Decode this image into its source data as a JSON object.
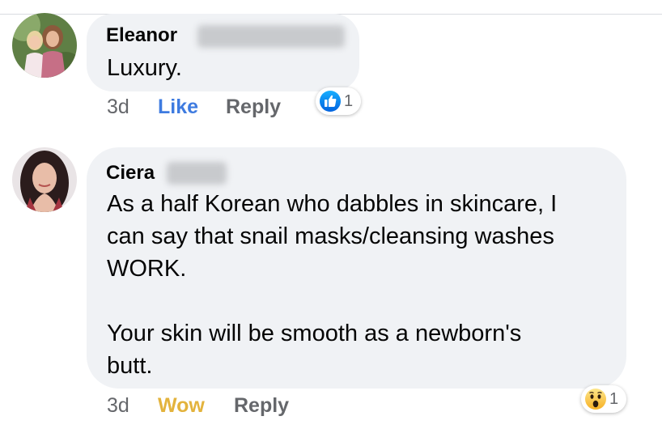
{
  "colors": {
    "bubble": "#f0f2f5",
    "like_blue": "#3e7be0",
    "wow_yellow": "#e3b33d",
    "muted_gray": "#65676b"
  },
  "comments": [
    {
      "author": "Eleanor",
      "text": "Luxury.",
      "timestamp": "3d",
      "reaction_action": "Like",
      "reply_label": "Reply",
      "reaction_icon": "like-icon",
      "reaction_count": "1"
    },
    {
      "author": "Ciera",
      "text": "As a half Korean who dabbles in skincare, I\ncan say that snail masks/cleansing washes\nWORK.\n\nYour skin will be smooth as a newborn's\nbutt.",
      "timestamp": "3d",
      "reaction_action": "Wow",
      "reply_label": "Reply",
      "reaction_icon": "wow-icon",
      "reaction_count": "1"
    }
  ]
}
